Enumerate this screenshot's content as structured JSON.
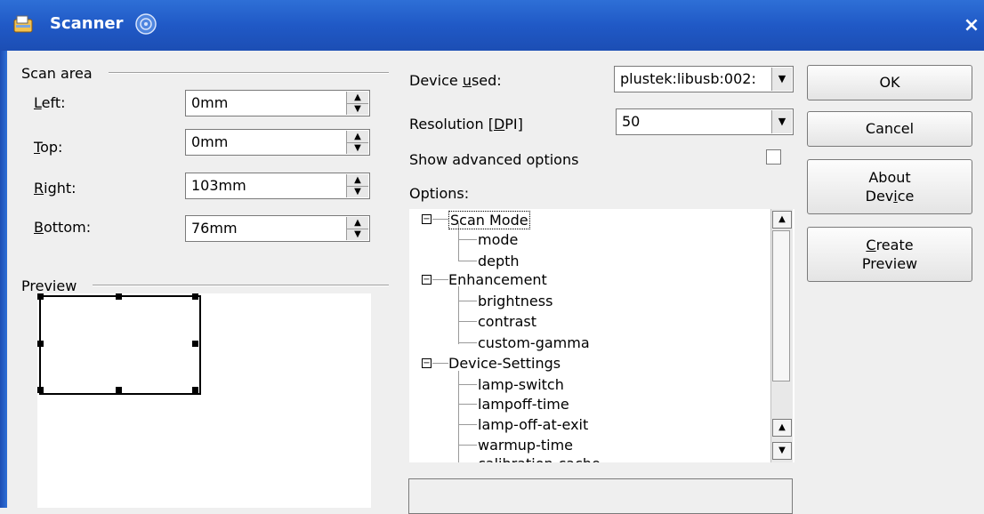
{
  "window": {
    "title": "Scanner",
    "close_glyph": "×"
  },
  "scan_area": {
    "label": "Scan area",
    "left": {
      "label_pre": "",
      "label_ul": "L",
      "label_post": "eft:",
      "value": "0mm"
    },
    "top": {
      "label_pre": "",
      "label_ul": "T",
      "label_post": "op:",
      "value": "0mm"
    },
    "right": {
      "label_pre": "",
      "label_ul": "R",
      "label_post": "ight:",
      "value": "103mm"
    },
    "bottom": {
      "label_pre": "",
      "label_ul": "B",
      "label_post": "ottom:",
      "value": "76mm"
    }
  },
  "preview": {
    "label": "Preview"
  },
  "device": {
    "label_pre": "Device ",
    "label_ul": "u",
    "label_post": "sed:",
    "value": "plustek:libusb:002:"
  },
  "resolution": {
    "label_pre": "Resolution [",
    "label_ul": "D",
    "label_post": "PI]",
    "value": "50"
  },
  "advanced": {
    "label": "Show advanced options",
    "checked": false
  },
  "options": {
    "label": "Options:",
    "tree": [
      {
        "label": "Scan Mode",
        "children": [
          "mode",
          "depth"
        ]
      },
      {
        "label": "Enhancement",
        "children": [
          "brightness",
          "contrast",
          "custom-gamma"
        ]
      },
      {
        "label": "Device-Settings",
        "children": [
          "lamp-switch",
          "lampoff-time",
          "lamp-off-at-exit",
          "warmup-time",
          "calibration-cache"
        ]
      }
    ]
  },
  "buttons": {
    "ok": "OK",
    "cancel": "Cancel",
    "about_line1": "About",
    "about_line2_pre": "Dev",
    "about_line2_ul": "i",
    "about_line2_post": "ce",
    "create_line1_ul": "C",
    "create_line1_post": "reate",
    "create_line2": "Preview"
  },
  "icons": {
    "app": "scanner-app-icon",
    "rollup": "roll-up-icon",
    "close": "close-icon",
    "spin_up": "▲",
    "spin_down": "▼",
    "combo_arrow": "▼",
    "expander": "−"
  }
}
